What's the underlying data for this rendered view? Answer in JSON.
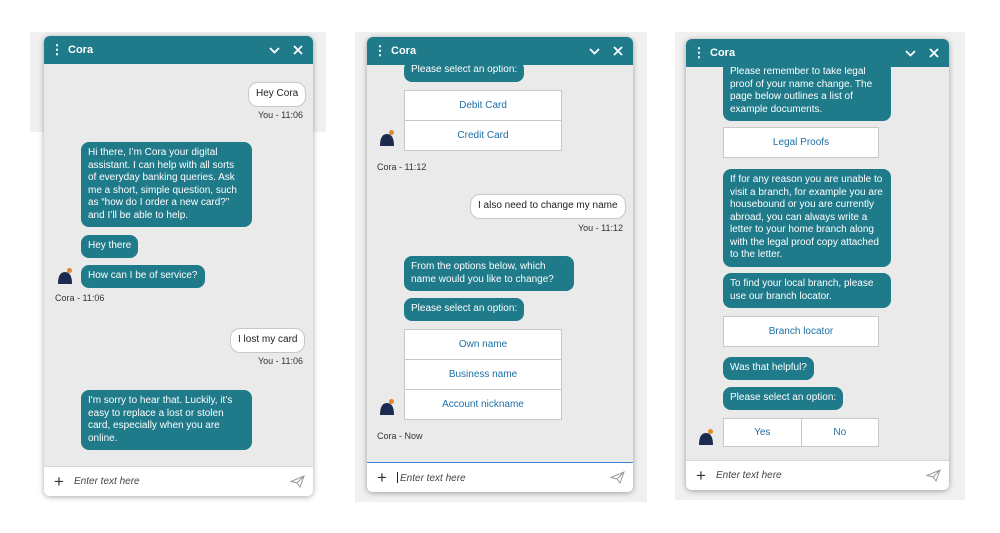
{
  "colors": {
    "header": "#1f7a8a",
    "bot_bubble": "#1f7a8a",
    "option_text": "#1d6fa5",
    "avatar_dot": "#e08a2c",
    "avatar_body": "#1b2a4e"
  },
  "windows": [
    {
      "title": "Cora",
      "input_placeholder": "Enter text here",
      "msg": {
        "u1": "Hey Cora",
        "ts_u1": "You - 11:06",
        "b1": "Hi there, I’m Cora your digital assistant. I can help with all sorts of everyday banking queries. Ask me a short, simple question, such as “how do I order a new card?” and I’ll be able to help.",
        "b2": "Hey there",
        "b3": "How can I be of service?",
        "ts_b": "Cora - 11:06",
        "u2": "I lost my card",
        "ts_u2": "You - 11:06",
        "b4": "I'm sorry to hear that. Luckily, it’s easy to replace a lost or stolen card, especially when you are online."
      }
    },
    {
      "title": "Cora",
      "input_placeholder": "Enter text here",
      "msg": {
        "b1": "Please select an option:",
        "opt1": [
          "Debit Card",
          "Credit Card"
        ],
        "ts_b1": "Cora - 11:12",
        "u1": "I also need to change my name",
        "ts_u1": "You - 11:12",
        "b2": "From the options below, which name would you like to change?",
        "b3": "Please select an option:",
        "opt2": [
          "Own name",
          "Business name",
          "Account nickname"
        ],
        "ts_b2": "Cora - Now"
      }
    },
    {
      "title": "Cora",
      "input_placeholder": "Enter text here",
      "msg": {
        "b1": "Please remember to take legal proof of your name change. The page below outlines a list of example documents.",
        "opt1": [
          "Legal Proofs"
        ],
        "b2": "If for any reason you are unable to visit a branch, for example you are housebound or you are currently abroad, you can always write a letter to your home branch along with the legal proof copy attached to the letter.",
        "b3": "To find your local branch, please use our branch locator.",
        "opt2": [
          "Branch locator"
        ],
        "b4": "Was that helpful?",
        "b5": "Please select an option:",
        "opt3": [
          "Yes",
          "No"
        ]
      }
    }
  ]
}
